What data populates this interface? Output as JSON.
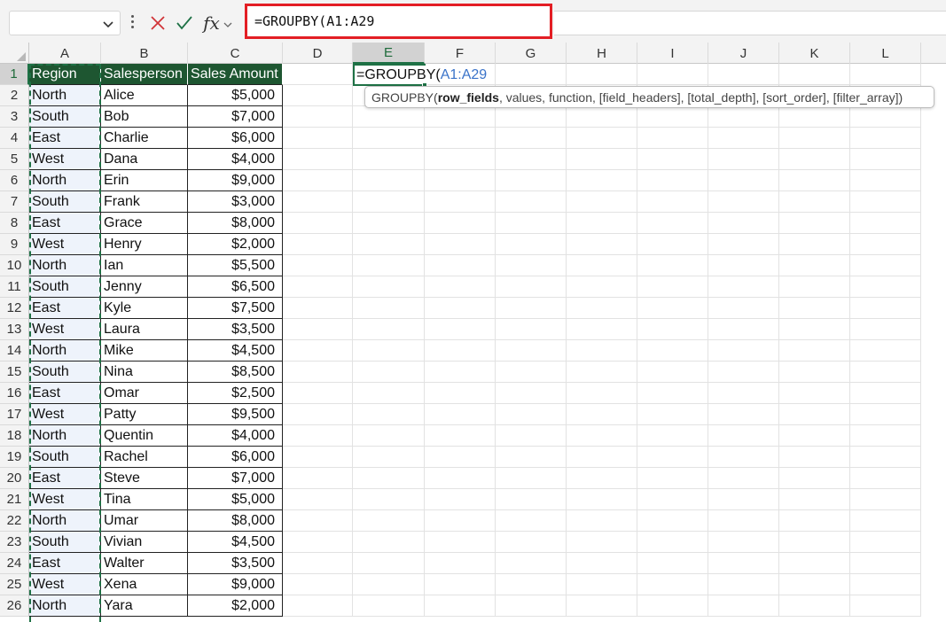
{
  "name_box": {
    "value": ""
  },
  "formula_bar": {
    "cancel_icon": "x-icon",
    "enter_icon": "check-icon",
    "fx_label": "fx",
    "formula": "=GROUPBY(A1:A29"
  },
  "columns": [
    "A",
    "B",
    "C",
    "D",
    "E",
    "F",
    "G",
    "H",
    "I",
    "J",
    "K",
    "L"
  ],
  "active_column": "E",
  "active_row": "1",
  "table": {
    "headers": [
      "Region",
      "Salesperson",
      "Sales Amount"
    ],
    "rows": [
      [
        "North",
        "Alice",
        "$5,000"
      ],
      [
        "South",
        "Bob",
        "$7,000"
      ],
      [
        "East",
        "Charlie",
        "$6,000"
      ],
      [
        "West",
        "Dana",
        "$4,000"
      ],
      [
        "North",
        "Erin",
        "$9,000"
      ],
      [
        "South",
        "Frank",
        "$3,000"
      ],
      [
        "East",
        "Grace",
        "$8,000"
      ],
      [
        "West",
        "Henry",
        "$2,000"
      ],
      [
        "North",
        "Ian",
        "$5,500"
      ],
      [
        "South",
        "Jenny",
        "$6,500"
      ],
      [
        "East",
        "Kyle",
        "$7,500"
      ],
      [
        "West",
        "Laura",
        "$3,500"
      ],
      [
        "North",
        "Mike",
        "$4,500"
      ],
      [
        "South",
        "Nina",
        "$8,500"
      ],
      [
        "East",
        "Omar",
        "$2,500"
      ],
      [
        "West",
        "Patty",
        "$9,500"
      ],
      [
        "North",
        "Quentin",
        "$4,000"
      ],
      [
        "South",
        "Rachel",
        "$6,000"
      ],
      [
        "East",
        "Steve",
        "$7,000"
      ],
      [
        "West",
        "Tina",
        "$5,000"
      ],
      [
        "North",
        "Umar",
        "$8,000"
      ],
      [
        "South",
        "Vivian",
        "$4,500"
      ],
      [
        "East",
        "Walter",
        "$3,500"
      ],
      [
        "West",
        "Xena",
        "$9,000"
      ],
      [
        "North",
        "Yara",
        "$2,000"
      ]
    ]
  },
  "editing_cell": {
    "prefix": "=GROUPBY(",
    "ref": "A1:A29"
  },
  "tooltip": {
    "fn": "GROUPBY(",
    "arg_current": "row_fields",
    "rest": ", values, function, [field_headers], [total_depth], [sort_order], [filter_array])"
  },
  "colors": {
    "header_fill": "#1e5631",
    "accent": "#1e7145",
    "highlight_border": "#e31e24",
    "reference_blue": "#3a73c9"
  }
}
